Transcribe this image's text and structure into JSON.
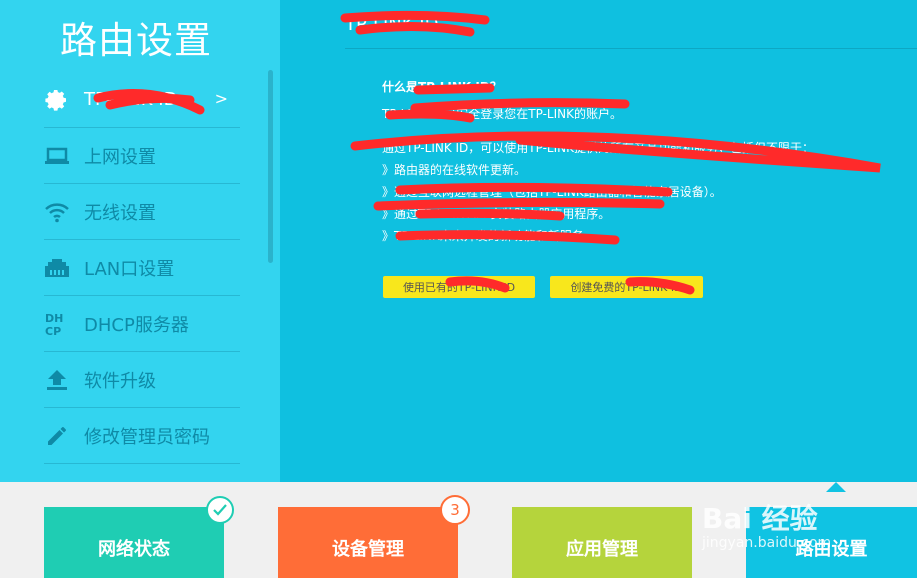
{
  "sidebar": {
    "title": "路由设置",
    "items": [
      {
        "label": "TP-LINK ID",
        "icon": "gear-icon",
        "active": true,
        "arrow": ">"
      },
      {
        "label": "上网设置",
        "icon": "laptop-icon"
      },
      {
        "label": "无线设置",
        "icon": "wifi-icon"
      },
      {
        "label": "LAN口设置",
        "icon": "lan-port-icon"
      },
      {
        "label": "DHCP服务器",
        "icon": "dhcp-icon"
      },
      {
        "label": "软件升级",
        "icon": "upload-icon"
      },
      {
        "label": "修改管理员密码",
        "icon": "pencil-icon"
      }
    ]
  },
  "main": {
    "header": "TP-LINK ID",
    "question": "什么是TP-LINK ID？",
    "lines": [
      "TP-LINK ID可安全登录您在TP-LINK的账户。",
      "通过TP-LINK ID，可以使用TP-LINK提供的所有产品功能和服务，包括但不限于：",
      "》路由器的在线软件更新。",
      "》通过互联网远程管理（包括TP-LINK路由器和智能家居设备）。",
      "》通过TP-LINK APP安装路由器应用程序。",
      "》TP-LINK未来开发的新功能和新服务。"
    ],
    "buttons": [
      {
        "label": "使用已有的TP-LINK ID"
      },
      {
        "label": "创建免费的TP-LINK ID"
      }
    ]
  },
  "tiles": [
    {
      "label": "网络状态",
      "icon": "check-icon"
    },
    {
      "label": "设备管理",
      "badge": "3"
    },
    {
      "label": "应用管理"
    },
    {
      "label": "路由设置"
    }
  ],
  "watermark": {
    "logo": "Bai 经验",
    "url": "jingyan.baidu.com"
  },
  "colors": {
    "sidebar_bg": "#33d4ef",
    "main_bg": "#0fc0e0",
    "button_yellow": "#f8e71c",
    "tile_green": "#1fcdb3",
    "tile_orange": "#ff6d37",
    "tile_lime": "#b5d43c",
    "tile_blue": "#10c3e3",
    "redaction_red": "#ff2a2a"
  }
}
